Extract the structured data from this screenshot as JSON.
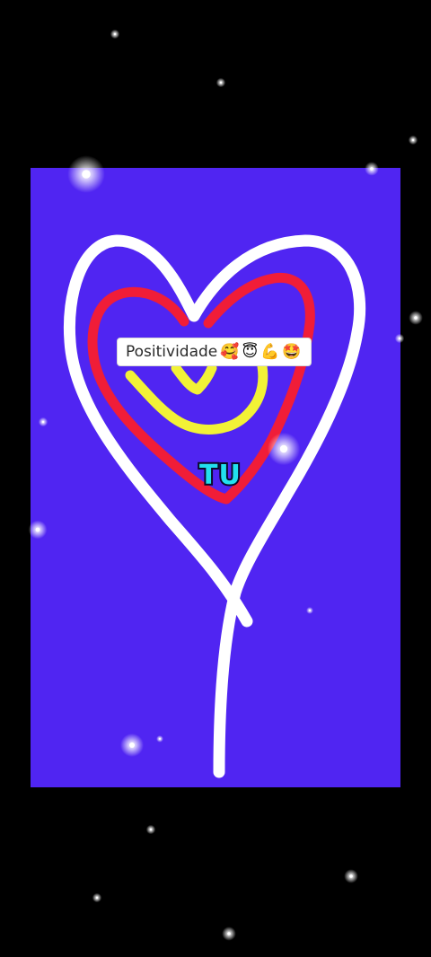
{
  "background_color": "#000000",
  "panel_color": "#5025f2",
  "heart": {
    "outer_color": "#ffffff",
    "middle_color": "#f01d38",
    "inner_color": "#f2f236"
  },
  "caption": {
    "text": "Positividade",
    "emojis": [
      "🥰",
      "😇",
      "💪",
      "🤩"
    ]
  },
  "tu_label": {
    "text": "TU",
    "fill_color": "#22e0ee",
    "outline_color": "#0b0b2a"
  },
  "decor": {
    "sparkle_icon": "sparkle-star"
  }
}
